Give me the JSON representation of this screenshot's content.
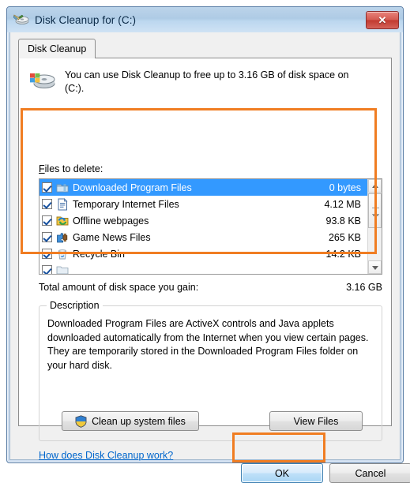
{
  "window": {
    "title": "Disk Cleanup for  (C:)",
    "title_icon": "disk-cleanup-icon",
    "close_label": "✕"
  },
  "tabs": [
    {
      "label": "Disk Cleanup",
      "active": true
    }
  ],
  "banner": {
    "icon": "hard-disk-icon",
    "text": "You can use Disk Cleanup to free up to 3.16 GB of disk space on (C:)."
  },
  "files_section": {
    "label_prefix": "F",
    "label_rest": "iles to delete:",
    "label_full": "Files to delete:",
    "items": [
      {
        "name": "Downloaded Program Files",
        "size": "0 bytes",
        "checked": true,
        "selected": true,
        "icon": "folder-icon"
      },
      {
        "name": "Temporary Internet Files",
        "size": "4.12 MB",
        "checked": true,
        "selected": false,
        "icon": "document-icon"
      },
      {
        "name": "Offline webpages",
        "size": "93.8 KB",
        "checked": true,
        "selected": false,
        "icon": "offline-folder-icon"
      },
      {
        "name": "Game News Files",
        "size": "265 KB",
        "checked": true,
        "selected": false,
        "icon": "game-puzzle-icon"
      },
      {
        "name": "Recycle Bin",
        "size": "14.2 KB",
        "checked": true,
        "selected": false,
        "icon": "recycle-bin-icon"
      },
      {
        "name": "",
        "size": "",
        "checked": true,
        "selected": false,
        "icon": "partial-icon"
      }
    ]
  },
  "total": {
    "label": "Total amount of disk space you gain:",
    "value": "3.16 GB"
  },
  "description": {
    "legend": "Description",
    "text": "Downloaded Program Files are ActiveX controls and Java applets downloaded automatically from the Internet when you view certain pages. They are temporarily stored in the Downloaded Program Files folder on your hard disk."
  },
  "buttons": {
    "clean_up_system_files": "Clean up system files",
    "clean_up_icon": "uac-shield-icon",
    "view_files": "View Files",
    "ok": "OK",
    "cancel": "Cancel"
  },
  "help_link": "How does Disk Cleanup work?",
  "colors": {
    "annotation": "#f07d22",
    "selection": "#3399ff",
    "link": "#0066cc",
    "titlebar": "#aecbe5",
    "close_button": "#c2392f"
  },
  "annotations": [
    {
      "name": "files-to-delete-highlight"
    },
    {
      "name": "ok-button-highlight"
    }
  ]
}
